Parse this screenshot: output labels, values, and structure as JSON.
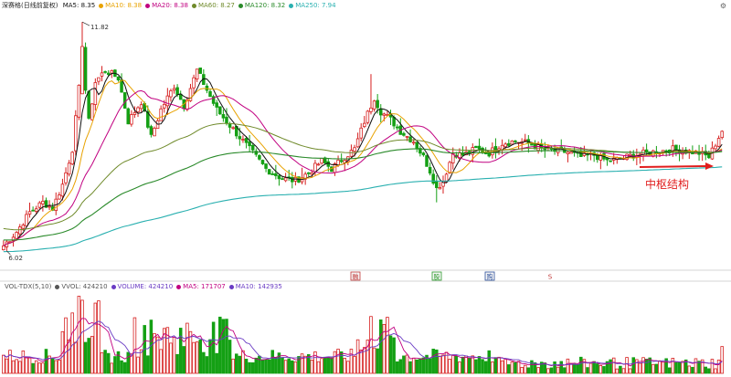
{
  "stock_title": "深赛格(日线前复权)",
  "ma_legend": [
    {
      "label": "MA5: 8.35",
      "color": "#111111"
    },
    {
      "label": "MA10: 8.38",
      "color": "#e8a200"
    },
    {
      "label": "MA20: 8.38",
      "color": "#c10080"
    },
    {
      "label": "MA60: 8.27",
      "color": "#6f8a2a"
    },
    {
      "label": "MA120: 8.32",
      "color": "#2a8a2a"
    },
    {
      "label": "MA250: 7.94",
      "color": "#2ab0b0"
    }
  ],
  "volume_legend": [
    {
      "label": "VOL-TDX(5,10)",
      "color": "#555555"
    },
    {
      "label": "VVOL: 424210",
      "color": "#555555"
    },
    {
      "label": "VOLUME: 424210",
      "color": "#6a3cc4"
    },
    {
      "label": "MA5: 171707",
      "color": "#c10080"
    },
    {
      "label": "MA10: 142935",
      "color": "#6a3cc4"
    }
  ],
  "settings_icon": "gear-icon",
  "chart_data": {
    "type": "candlestick",
    "price_axis": {
      "min": 5.6,
      "max": 12.1
    },
    "volume_axis": {
      "min": 0,
      "max": 1.0
    },
    "annotations": {
      "high_label": "11.82",
      "high_value": 11.82,
      "low_label": "6.02",
      "low_value": 6.02,
      "pivot_label": "中枢结构"
    },
    "event_markers": [
      {
        "label": "融",
        "color": "#c03a3a",
        "style": "box"
      },
      {
        "label": "股",
        "color": "#2a9a2a",
        "style": "box"
      },
      {
        "label": "购",
        "color": "#2a4e9a",
        "style": "box"
      },
      {
        "label": "S",
        "color": "#c03a3a",
        "style": "text"
      }
    ],
    "colors": {
      "up": "#d61f1f",
      "down": "#14a014",
      "ma5": "#111111",
      "ma10": "#e8a200",
      "ma20": "#c10080",
      "ma60": "#6f8a2a",
      "ma120": "#2a8a2a",
      "ma250": "#2ab0b0",
      "arrow": "#e11d1d",
      "pivot_label": "#e11d1d"
    }
  }
}
